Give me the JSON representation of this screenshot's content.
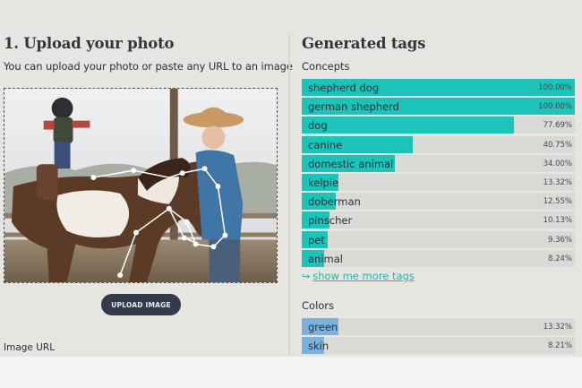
{
  "upload": {
    "heading": "1. Upload your photo",
    "subtext": "You can upload your photo or paste any URL to an image",
    "button_label": "UPLOAD IMAGE",
    "url_label": "Image URL"
  },
  "results": {
    "heading": "Generated tags",
    "concepts_label": "Concepts",
    "concepts": [
      {
        "name": "shepherd dog",
        "score": "100.00%",
        "level": 1.0
      },
      {
        "name": "german shepherd",
        "score": "100.00%",
        "level": 1.0
      },
      {
        "name": "dog",
        "score": "77.69%",
        "level": 0.7769
      },
      {
        "name": "canine",
        "score": "40.75%",
        "level": 0.4075
      },
      {
        "name": "domestic animal",
        "score": "34.00%",
        "level": 0.34
      },
      {
        "name": "kelpie",
        "score": "13.32%",
        "level": 0.1332
      },
      {
        "name": "doberman",
        "score": "12.55%",
        "level": 0.1255
      },
      {
        "name": "pinscher",
        "score": "10.13%",
        "level": 0.1013
      },
      {
        "name": "pet",
        "score": "9.36%",
        "level": 0.0936
      },
      {
        "name": "animal",
        "score": "8.24%",
        "level": 0.0824
      }
    ],
    "more_tags_label": "show me more tags",
    "more_tags_icon": "return-arrow-icon",
    "colors_label": "Colors",
    "colors": [
      {
        "name": "green",
        "score": "13.32%",
        "level": 0.1332
      },
      {
        "name": "skin",
        "score": "8.21%",
        "level": 0.0821
      }
    ]
  },
  "theme": {
    "concept_bar_color": "#1cc3b8",
    "color_bar_color": "#7ab2de",
    "button_color": "#333a49",
    "link_color": "#1eb8ad"
  }
}
